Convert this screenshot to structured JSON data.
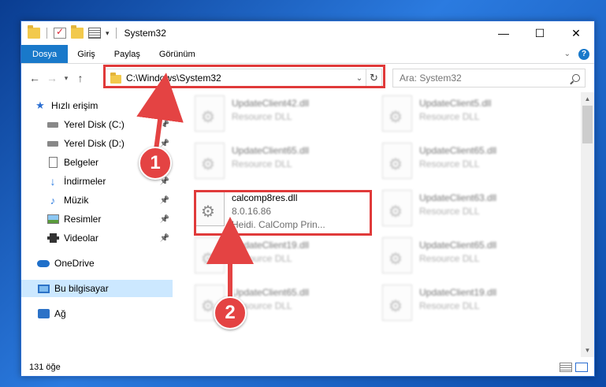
{
  "window": {
    "title": "System32",
    "controls": {
      "minimize": "—",
      "maximize": "☐",
      "close": "✕"
    }
  },
  "ribbon": {
    "tabs": [
      "Dosya",
      "Giriş",
      "Paylaş",
      "Görünüm"
    ],
    "help": "?"
  },
  "nav": {
    "address": "C:\\Windows\\System32",
    "search_placeholder": "Ara: System32"
  },
  "sidebar": {
    "items": [
      {
        "label": "Hızlı erişim",
        "icon": "star-icon",
        "pinned": false
      },
      {
        "label": "Yerel Disk (C:)",
        "icon": "drive-icon",
        "pinned": true
      },
      {
        "label": "Yerel Disk (D:)",
        "icon": "drive-icon",
        "pinned": true
      },
      {
        "label": "Belgeler",
        "icon": "document-icon",
        "pinned": true
      },
      {
        "label": "İndirmeler",
        "icon": "download-icon",
        "pinned": true
      },
      {
        "label": "Müzik",
        "icon": "music-icon",
        "pinned": true
      },
      {
        "label": "Resimler",
        "icon": "pictures-icon",
        "pinned": true
      },
      {
        "label": "Videolar",
        "icon": "video-icon",
        "pinned": true
      },
      {
        "label": "OneDrive",
        "icon": "cloud-icon",
        "pinned": false
      },
      {
        "label": "Bu bilgisayar",
        "icon": "computer-icon",
        "pinned": false,
        "selected": true
      },
      {
        "label": "Ağ",
        "icon": "network-icon",
        "pinned": false
      }
    ]
  },
  "files": [
    {
      "name": "UpdateClient42.dll",
      "line2": "Resource DLL",
      "blurred": true
    },
    {
      "name": "UpdateClient5.dll",
      "line2": "Resource DLL",
      "blurred": true
    },
    {
      "name": "UpdateClient65.dll",
      "line2": "Resource DLL",
      "blurred": true
    },
    {
      "name": "UpdateClient65.dll",
      "line2": "Resource DLL",
      "blurred": true
    },
    {
      "name": "calcomp8res.dll",
      "line2": "8.0.16.86",
      "line3": "Heidi. CalComp Prin...",
      "blurred": false
    },
    {
      "name": "UpdateClient63.dll",
      "line2": "Resource DLL",
      "blurred": true
    },
    {
      "name": "UpdateClient19.dll",
      "line2": "Resource DLL",
      "blurred": true
    },
    {
      "name": "UpdateClient65.dll",
      "line2": "Resource DLL",
      "blurred": true
    },
    {
      "name": "UpdateClient65.dll",
      "line2": "Resource DLL",
      "blurred": true
    },
    {
      "name": "UpdateClient19.dll",
      "line2": "Resource DLL",
      "blurred": true
    }
  ],
  "status": {
    "count": "131 öğe"
  },
  "callouts": [
    "1",
    "2"
  ],
  "colors": {
    "accent": "#1979ca",
    "highlight": "#e03a3a",
    "selected": "#cce8ff"
  }
}
